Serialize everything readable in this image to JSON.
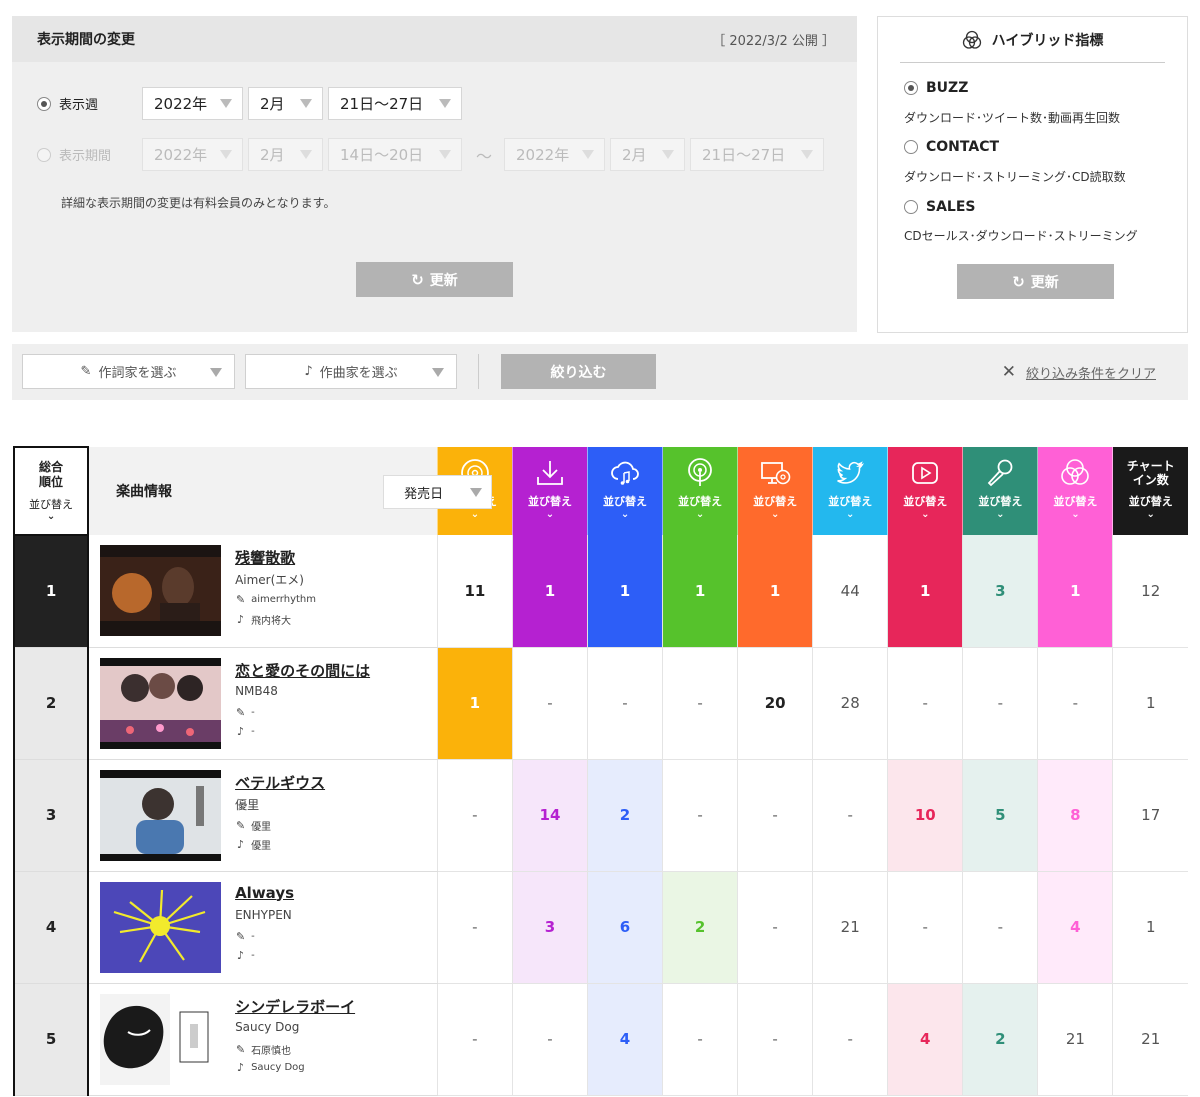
{
  "period": {
    "title": "表示期間の変更",
    "published": "［ 2022/3/2 公開 ］",
    "week_label": "表示週",
    "week_year": "2022年",
    "week_month": "2月",
    "week_range": "21日〜27日",
    "range_label": "表示期間",
    "from_year": "2022年",
    "from_month": "2月",
    "from_range": "14日〜20日",
    "tilde": "〜",
    "to_year": "2022年",
    "to_month": "2月",
    "to_range": "21日〜27日",
    "note": "詳細な表示期間の変更は有料会員のみとなります。",
    "update_label": "更新"
  },
  "hybrid": {
    "title": "ハイブリッド指標",
    "options": [
      {
        "label": "BUZZ",
        "desc": "ダウンロード･ツイート数･動画再生回数",
        "selected": true
      },
      {
        "label": "CONTACT",
        "desc": "ダウンロード･ストリーミング･CD読取数",
        "selected": false
      },
      {
        "label": "SALES",
        "desc": "CDセールス･ダウンロード･ストリーミング",
        "selected": false
      }
    ],
    "update_label": "更新"
  },
  "filter": {
    "lyricist_placeholder": "作詞家を選ぶ",
    "composer_placeholder": "作曲家を選ぶ",
    "narrow_label": "絞り込む",
    "clear_label": "絞り込み条件をクリア"
  },
  "table": {
    "rank_header": "総合\n順位",
    "rank_sort": "並び替え",
    "info_header": "楽曲情報",
    "release_sort": "発売日",
    "sort_label": "並び替え",
    "chart_in_header": "チャート\nイン数",
    "metrics": [
      {
        "key": "cd",
        "icon": "cd-icon",
        "color": "#fbb20a",
        "light": "#ffffff"
      },
      {
        "key": "download",
        "icon": "download-icon",
        "color": "#b521d1",
        "light": "#f6e6fa"
      },
      {
        "key": "streaming",
        "icon": "cloud-music-icon",
        "color": "#2d5ef7",
        "light": "#e6ecfd"
      },
      {
        "key": "radio",
        "icon": "radio-icon",
        "color": "#56c22c",
        "light": "#eaf6e4"
      },
      {
        "key": "lookup",
        "icon": "pc-cd-icon",
        "color": "#ff6a2c",
        "light": "#ffffff"
      },
      {
        "key": "twitter",
        "icon": "twitter-icon",
        "color": "#23b8ee",
        "light": "#ffffff"
      },
      {
        "key": "video",
        "icon": "youtube-icon",
        "color": "#e7265a",
        "light": "#fce6ec"
      },
      {
        "key": "karaoke",
        "icon": "microphone-icon",
        "color": "#2f8f78",
        "light": "#e5f1ee"
      },
      {
        "key": "hybrid",
        "icon": "hybrid-icon",
        "color": "#ff60d6",
        "light": "#ffeafa"
      },
      {
        "key": "chart_in",
        "icon": "",
        "color": "#1a1a1a",
        "light": "#ffffff"
      }
    ],
    "rows": [
      {
        "rank": "1",
        "title": "残響散歌",
        "artist": "Aimer(エメ)",
        "lyricist": "aimerrhythm",
        "composer": "飛内将大",
        "values": [
          "11",
          "1",
          "1",
          "1",
          "1",
          "44",
          "1",
          "3",
          "1",
          "12"
        ]
      },
      {
        "rank": "2",
        "title": "恋と愛のその間には",
        "artist": "NMB48",
        "lyricist": "-",
        "composer": "-",
        "values": [
          "1",
          "-",
          "-",
          "-",
          "20",
          "28",
          "-",
          "-",
          "-",
          "1"
        ]
      },
      {
        "rank": "3",
        "title": "ベテルギウス",
        "artist": "優里",
        "lyricist": "優里",
        "composer": "優里",
        "values": [
          "-",
          "14",
          "2",
          "-",
          "-",
          "-",
          "10",
          "5",
          "8",
          "17"
        ]
      },
      {
        "rank": "4",
        "title": "Always",
        "artist": "ENHYPEN",
        "lyricist": "-",
        "composer": "-",
        "values": [
          "-",
          "3",
          "6",
          "2",
          "-",
          "21",
          "-",
          "-",
          "4",
          "1"
        ]
      },
      {
        "rank": "5",
        "title": "シンデレラボーイ",
        "artist": "Saucy Dog",
        "lyricist": "石原慎也",
        "composer": "Saucy Dog",
        "values": [
          "-",
          "-",
          "4",
          "-",
          "-",
          "-",
          "4",
          "2",
          "21",
          "21"
        ]
      }
    ]
  }
}
